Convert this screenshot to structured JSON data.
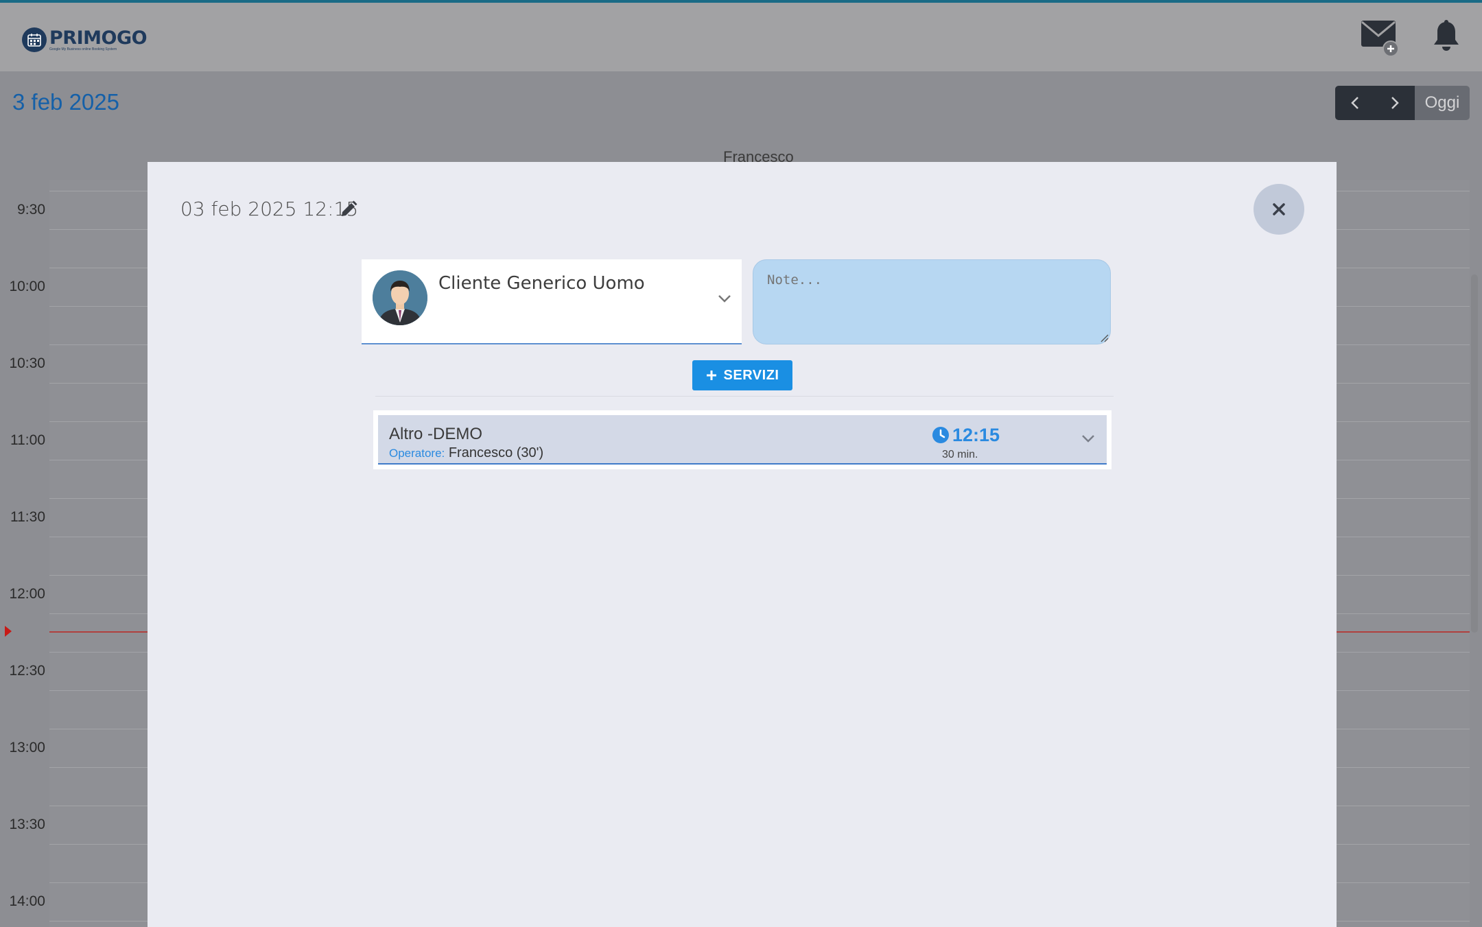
{
  "header": {
    "logo_text": "PRIMOGO",
    "logo_tagline": "Google My Business online Booking System",
    "mail_icon": "mail-plus-icon",
    "bell_icon": "bell-icon"
  },
  "calendar": {
    "date_title": "3 feb 2025",
    "nav": {
      "prev_icon": "chevron-left-icon",
      "next_icon": "chevron-right-icon",
      "today_label": "Oggi"
    },
    "column_header": "Francesco",
    "time_slots": [
      "9:30",
      "10:00",
      "10:30",
      "11:00",
      "11:30",
      "12:00",
      "12:30",
      "13:00",
      "13:30",
      "14:00"
    ]
  },
  "modal": {
    "datetime": "03 feb 2025 12:15",
    "edit_icon": "pencil-icon",
    "close_icon": "close-icon",
    "client": {
      "name": "Cliente Generico Uomo",
      "avatar": "man-avatar"
    },
    "notes": {
      "placeholder": "Note...",
      "value": ""
    },
    "add_services_label": "SERVIZI",
    "services": [
      {
        "name": "Altro -DEMO",
        "operator_label": "Operatore:",
        "operator_value": "Francesco (30')",
        "time": "12:15",
        "duration": "30 min."
      }
    ]
  },
  "colors": {
    "accent": "#1a8fe3",
    "date_title": "#1560a8",
    "time_text": "#2a8ae0",
    "now_line": "#c81a16"
  }
}
